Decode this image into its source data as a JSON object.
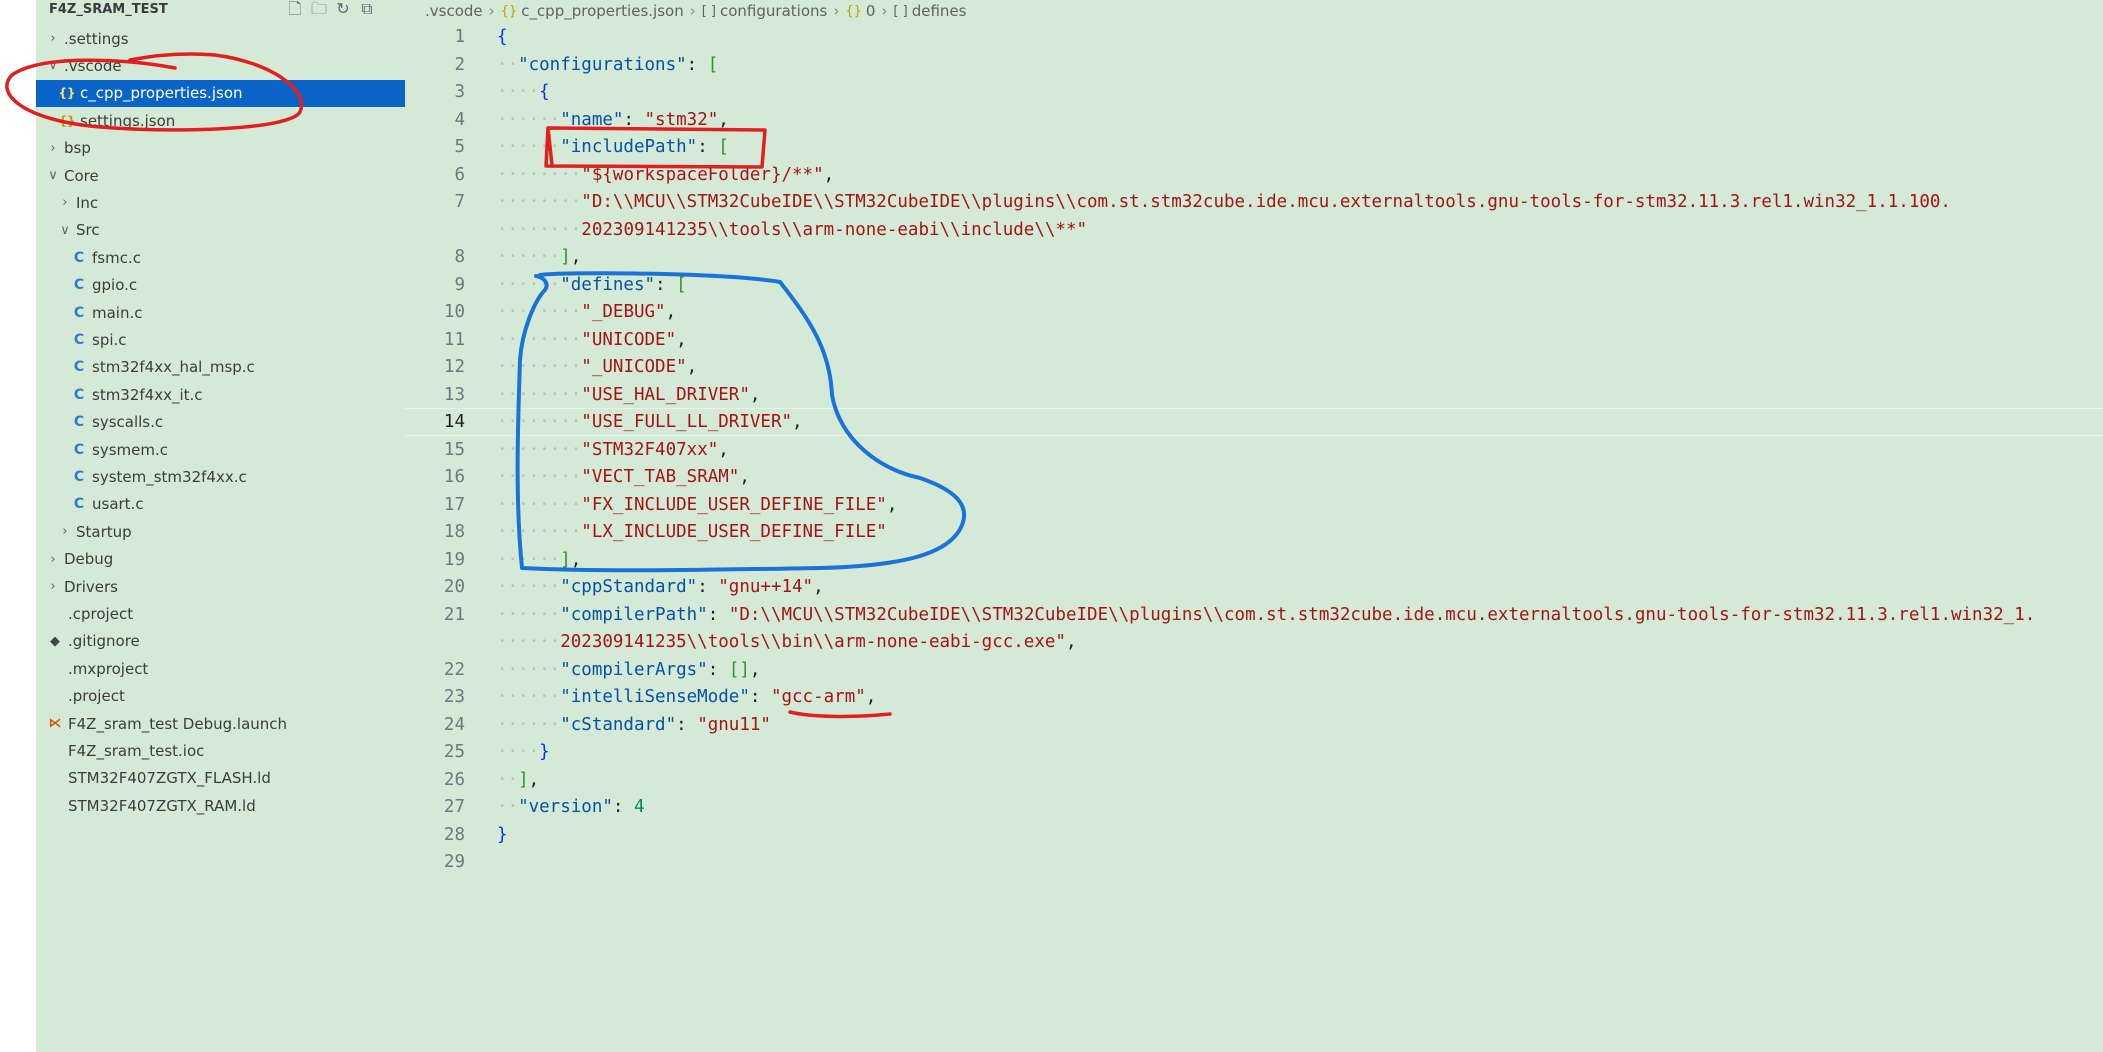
{
  "explorer": {
    "title": "F4Z_SRAM_TEST",
    "actions": [
      {
        "name": "new-file-icon",
        "glyph": "🗋"
      },
      {
        "name": "new-folder-icon",
        "glyph": "🗀"
      },
      {
        "name": "refresh-icon",
        "glyph": "↻"
      },
      {
        "name": "collapse-all-icon",
        "glyph": "⧉"
      }
    ],
    "items": [
      {
        "label": ".settings",
        "kind": "folder",
        "expanded": false,
        "depth": 0
      },
      {
        "label": ".vscode",
        "kind": "folder",
        "expanded": true,
        "depth": 0
      },
      {
        "label": "c_cpp_properties.json",
        "kind": "json",
        "depth": 1,
        "selected": true
      },
      {
        "label": "settings.json",
        "kind": "json",
        "depth": 1
      },
      {
        "label": "bsp",
        "kind": "folder",
        "expanded": false,
        "depth": 0
      },
      {
        "label": "Core",
        "kind": "folder",
        "expanded": true,
        "depth": 0
      },
      {
        "label": "Inc",
        "kind": "folder",
        "expanded": false,
        "depth": 1
      },
      {
        "label": "Src",
        "kind": "folder",
        "expanded": true,
        "depth": 1
      },
      {
        "label": "fsmc.c",
        "kind": "c",
        "depth": 2
      },
      {
        "label": "gpio.c",
        "kind": "c",
        "depth": 2
      },
      {
        "label": "main.c",
        "kind": "c",
        "depth": 2
      },
      {
        "label": "spi.c",
        "kind": "c",
        "depth": 2
      },
      {
        "label": "stm32f4xx_hal_msp.c",
        "kind": "c",
        "depth": 2
      },
      {
        "label": "stm32f4xx_it.c",
        "kind": "c",
        "depth": 2
      },
      {
        "label": "syscalls.c",
        "kind": "c",
        "depth": 2
      },
      {
        "label": "sysmem.c",
        "kind": "c",
        "depth": 2
      },
      {
        "label": "system_stm32f4xx.c",
        "kind": "c",
        "depth": 2
      },
      {
        "label": "usart.c",
        "kind": "c",
        "depth": 2
      },
      {
        "label": "Startup",
        "kind": "folder",
        "expanded": false,
        "depth": 1
      },
      {
        "label": "Debug",
        "kind": "folder",
        "expanded": false,
        "depth": 0
      },
      {
        "label": "Drivers",
        "kind": "folder",
        "expanded": false,
        "depth": 0
      },
      {
        "label": ".cproject",
        "kind": "file",
        "depth": 0
      },
      {
        "label": ".gitignore",
        "kind": "git",
        "depth": 0
      },
      {
        "label": ".mxproject",
        "kind": "file",
        "depth": 0
      },
      {
        "label": ".project",
        "kind": "file",
        "depth": 0
      },
      {
        "label": "F4Z_sram_test Debug.launch",
        "kind": "launch",
        "depth": 0
      },
      {
        "label": "F4Z_sram_test.ioc",
        "kind": "file",
        "depth": 0
      },
      {
        "label": "STM32F407ZGTX_FLASH.ld",
        "kind": "file",
        "depth": 0
      },
      {
        "label": "STM32F407ZGTX_RAM.ld",
        "kind": "file",
        "depth": 0
      }
    ]
  },
  "breadcrumb": [
    {
      "label": ".vscode",
      "icon": ""
    },
    {
      "label": "c_cpp_properties.json",
      "icon": "{}"
    },
    {
      "label": "configurations",
      "icon": "[ ]"
    },
    {
      "label": "0",
      "icon": "{}"
    },
    {
      "label": "defines",
      "icon": "[ ]"
    }
  ],
  "editor": {
    "current_line": 14,
    "lines": [
      {
        "n": "1",
        "ind": 0,
        "t": [
          [
            "br",
            "{"
          ]
        ]
      },
      {
        "n": "2",
        "ind": 1,
        "t": [
          [
            "key",
            "\"configurations\""
          ],
          [
            "pun",
            ": "
          ],
          [
            "br2",
            "["
          ]
        ]
      },
      {
        "n": "3",
        "ind": 2,
        "t": [
          [
            "br",
            "{"
          ]
        ]
      },
      {
        "n": "4",
        "ind": 3,
        "t": [
          [
            "key",
            "\"name\""
          ],
          [
            "pun",
            ": "
          ],
          [
            "str",
            "\"stm32\""
          ],
          [
            "pun",
            ","
          ]
        ]
      },
      {
        "n": "5",
        "ind": 3,
        "t": [
          [
            "key",
            "\"includePath\""
          ],
          [
            "pun",
            ": "
          ],
          [
            "br2",
            "["
          ]
        ]
      },
      {
        "n": "6",
        "ind": 4,
        "t": [
          [
            "str",
            "\"${workspaceFolder}/**\""
          ],
          [
            "pun",
            ","
          ]
        ]
      },
      {
        "n": "7",
        "ind": 4,
        "t": [
          [
            "str",
            "\"D:\\\\MCU\\\\STM32CubeIDE\\\\STM32CubeIDE\\\\plugins\\\\com.st.stm32cube.ide.mcu.externaltools.gnu-tools-for-stm32.11.3.rel1.win32_1.1.100."
          ]
        ]
      },
      {
        "n": "",
        "ind": 4,
        "t": [
          [
            "str",
            "202309141235\\\\tools\\\\arm-none-eabi\\\\include\\\\**\""
          ]
        ]
      },
      {
        "n": "8",
        "ind": 3,
        "t": [
          [
            "br2",
            "]"
          ],
          [
            "pun",
            ","
          ]
        ]
      },
      {
        "n": "9",
        "ind": 3,
        "t": [
          [
            "key",
            "\"defines\""
          ],
          [
            "pun",
            ": "
          ],
          [
            "br2",
            "["
          ]
        ]
      },
      {
        "n": "10",
        "ind": 4,
        "t": [
          [
            "str",
            "\"_DEBUG\""
          ],
          [
            "pun",
            ","
          ]
        ]
      },
      {
        "n": "11",
        "ind": 4,
        "t": [
          [
            "str",
            "\"UNICODE\""
          ],
          [
            "pun",
            ","
          ]
        ]
      },
      {
        "n": "12",
        "ind": 4,
        "t": [
          [
            "str",
            "\"_UNICODE\""
          ],
          [
            "pun",
            ","
          ]
        ]
      },
      {
        "n": "13",
        "ind": 4,
        "t": [
          [
            "str",
            "\"USE_HAL_DRIVER\""
          ],
          [
            "pun",
            ","
          ]
        ]
      },
      {
        "n": "14",
        "ind": 4,
        "t": [
          [
            "str",
            "\"USE_FULL_LL_DRIVER\""
          ],
          [
            "pun",
            ","
          ]
        ]
      },
      {
        "n": "15",
        "ind": 4,
        "t": [
          [
            "str",
            "\"STM32F407xx\""
          ],
          [
            "pun",
            ","
          ]
        ]
      },
      {
        "n": "16",
        "ind": 4,
        "t": [
          [
            "str",
            "\"VECT_TAB_SRAM\""
          ],
          [
            "pun",
            ","
          ]
        ]
      },
      {
        "n": "17",
        "ind": 4,
        "t": [
          [
            "str",
            "\"FX_INCLUDE_USER_DEFINE_FILE\""
          ],
          [
            "pun",
            ","
          ]
        ]
      },
      {
        "n": "18",
        "ind": 4,
        "t": [
          [
            "str",
            "\"LX_INCLUDE_USER_DEFINE_FILE\""
          ]
        ]
      },
      {
        "n": "19",
        "ind": 3,
        "t": [
          [
            "br2",
            "]"
          ],
          [
            "pun",
            ","
          ]
        ]
      },
      {
        "n": "20",
        "ind": 3,
        "t": [
          [
            "key",
            "\"cppStandard\""
          ],
          [
            "pun",
            ": "
          ],
          [
            "str",
            "\"gnu++14\""
          ],
          [
            "pun",
            ","
          ]
        ]
      },
      {
        "n": "21",
        "ind": 3,
        "t": [
          [
            "key",
            "\"compilerPath\""
          ],
          [
            "pun",
            ": "
          ],
          [
            "str",
            "\"D:\\\\MCU\\\\STM32CubeIDE\\\\STM32CubeIDE\\\\plugins\\\\com.st.stm32cube.ide.mcu.externaltools.gnu-tools-for-stm32.11.3.rel1.win32_1."
          ]
        ]
      },
      {
        "n": "",
        "ind": 3,
        "t": [
          [
            "str",
            "202309141235\\\\tools\\\\bin\\\\arm-none-eabi-gcc.exe\""
          ],
          [
            "pun",
            ","
          ]
        ]
      },
      {
        "n": "22",
        "ind": 3,
        "t": [
          [
            "key",
            "\"compilerArgs\""
          ],
          [
            "pun",
            ": "
          ],
          [
            "br2",
            "[]"
          ],
          [
            "pun",
            ","
          ]
        ]
      },
      {
        "n": "23",
        "ind": 3,
        "t": [
          [
            "key",
            "\"intelliSenseMode\""
          ],
          [
            "pun",
            ": "
          ],
          [
            "str",
            "\"gcc-arm\""
          ],
          [
            "pun",
            ","
          ]
        ]
      },
      {
        "n": "24",
        "ind": 3,
        "t": [
          [
            "key",
            "\"cStandard\""
          ],
          [
            "pun",
            ": "
          ],
          [
            "str",
            "\"gnu11\""
          ]
        ]
      },
      {
        "n": "25",
        "ind": 2,
        "t": [
          [
            "br",
            "}"
          ]
        ]
      },
      {
        "n": "26",
        "ind": 1,
        "t": [
          [
            "br2",
            "]"
          ],
          [
            "pun",
            ","
          ]
        ]
      },
      {
        "n": "27",
        "ind": 1,
        "t": [
          [
            "key",
            "\"version\""
          ],
          [
            "pun",
            ": "
          ],
          [
            "num",
            "4"
          ]
        ]
      },
      {
        "n": "28",
        "ind": 0,
        "t": [
          [
            "br",
            "}"
          ]
        ]
      },
      {
        "n": "29",
        "ind": 0,
        "t": []
      }
    ]
  },
  "annotation_colors": {
    "red": "#e02020",
    "blue": "#1a73d9"
  }
}
